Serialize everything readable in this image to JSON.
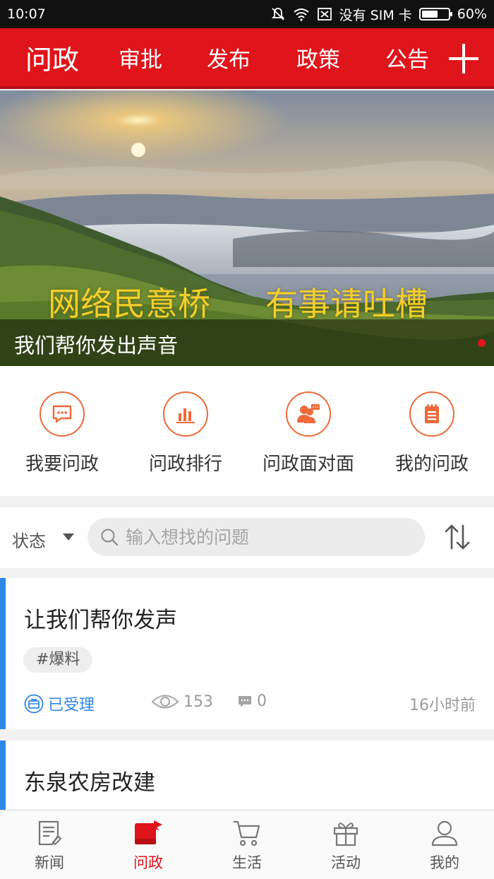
{
  "status_bar": {
    "time": "10:07",
    "sim": "没有 SIM 卡",
    "battery": "60%",
    "battery_level": 0.6
  },
  "header": {
    "tabs": [
      "问政",
      "审批",
      "发布",
      "政策",
      "公告"
    ],
    "active_tab": "问政",
    "accent": "#e0141b"
  },
  "banner": {
    "slogan_left": "网络民意桥",
    "slogan_right": "有事请吐槽",
    "caption": "我们帮你发出声音"
  },
  "quick_actions": [
    {
      "label": "我要问政",
      "icon": "chat-bubble-icon"
    },
    {
      "label": "问政排行",
      "icon": "bar-chart-icon"
    },
    {
      "label": "问政面对面",
      "icon": "people-chat-icon"
    },
    {
      "label": "我的问政",
      "icon": "notepad-icon"
    }
  ],
  "filter": {
    "state_label": "状态",
    "search_placeholder": "输入想找的问题"
  },
  "posts": [
    {
      "title": "让我们帮你发声",
      "tag": "#爆料",
      "status": "已受理",
      "views": "153",
      "comments": "0",
      "time": "16小时前"
    },
    {
      "title": "东泉农房改建"
    }
  ],
  "bottom_nav": {
    "items": [
      "新闻",
      "问政",
      "生活",
      "活动",
      "我的"
    ],
    "active": "问政"
  }
}
